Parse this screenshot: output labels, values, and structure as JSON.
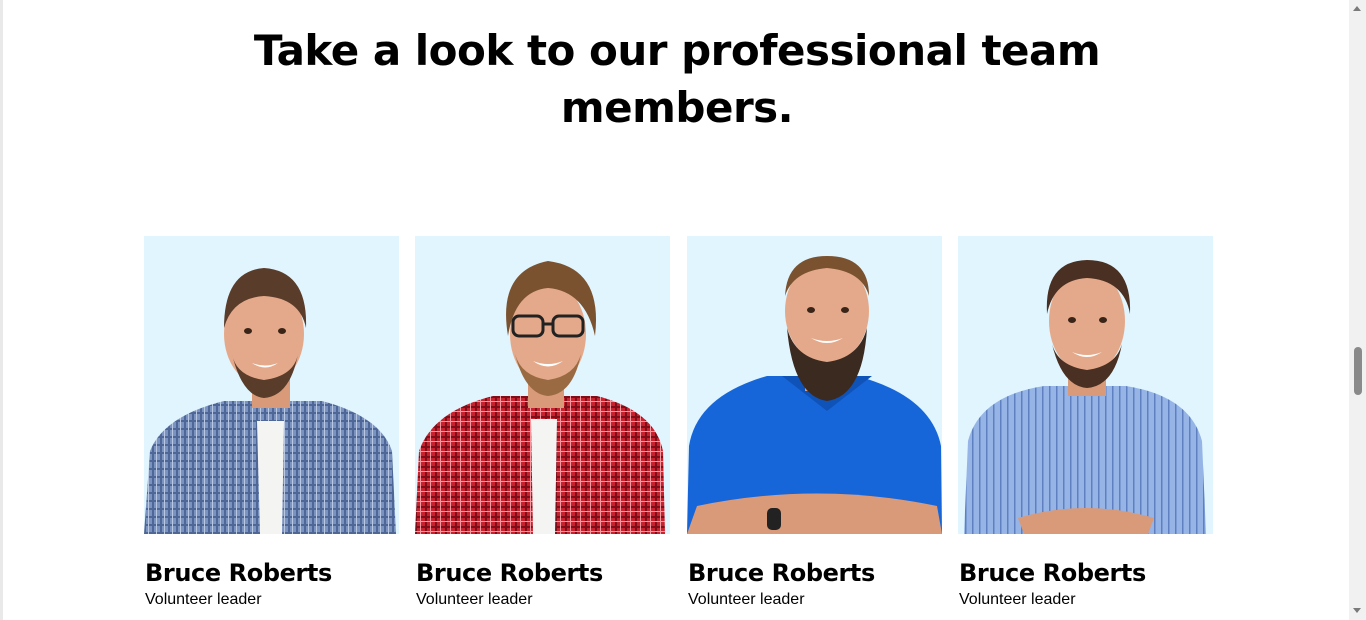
{
  "section": {
    "heading_line1": "Take a look to our professional team",
    "heading_line2": "members."
  },
  "team": [
    {
      "name": "Bruce Roberts",
      "role": "Volunteer leader",
      "shirt_color": "#6d86b3",
      "shirt_pattern": "check-blue"
    },
    {
      "name": "Bruce Roberts",
      "role": "Volunteer leader",
      "shirt_color": "#c9222e",
      "shirt_pattern": "check-red"
    },
    {
      "name": "Bruce Roberts",
      "role": "Volunteer leader",
      "shirt_color": "#1766d9",
      "shirt_pattern": "polo-blue"
    },
    {
      "name": "Bruce Roberts",
      "role": "Volunteer leader",
      "shirt_color": "#8fb1e3",
      "shirt_pattern": "stripe-light-blue"
    }
  ],
  "colors": {
    "photo_background": "#e0f5fd",
    "skin": "#e4a98a",
    "hair": "#5a3c2a"
  }
}
